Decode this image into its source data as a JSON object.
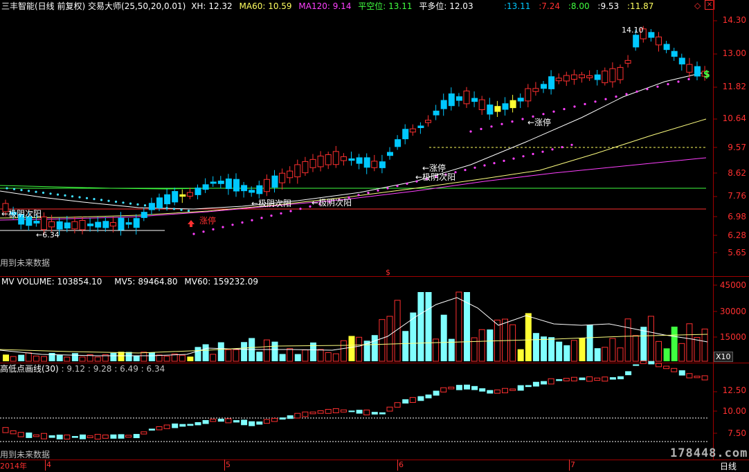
{
  "main_header": {
    "stock_name": "三丰智能(日线 前复权)",
    "indicator": "交易大师(25,50,20,0.01)",
    "xh_label": "XH:",
    "xh_value": "12.32",
    "ma60_label": "MA60:",
    "ma60_value": "10.59",
    "ma120_label": "MA120:",
    "ma120_value": "9.14",
    "pkw_label": "平空位:",
    "pkw_value": "13.11",
    "pdw_label": "平多位:",
    "pdw_value": "12.03",
    "right_values": [
      ":13.11",
      ":7.24",
      ":8.00",
      ":9.53",
      ":11.87"
    ]
  },
  "main_axis": [
    "14.30",
    "13.00",
    "11.82",
    "10.64",
    "9.57",
    "8.62",
    "7.76",
    "6.98",
    "6.28",
    "5.65"
  ],
  "main_annotations": {
    "high_label": "14.10",
    "low_label": "←6.34",
    "future_warning": "用到未来数据",
    "signal_jiyin1": "←极阴次阳",
    "signal_zhangting1": "涨停",
    "signal_jiyin2": "←极阴次阳",
    "signal_jiyin3": "←极阴次阳",
    "signal_zhangting2": "←涨停",
    "signal_jiyin4": "←极阴次阳",
    "signal_zhangting3": "←涨停",
    "dollar_mark": "$",
    "dollar_mark2": "$"
  },
  "volume_header": {
    "label": "MV VOLUME:",
    "value": "103854.10",
    "mv5_label": "MV5:",
    "mv5_value": "89464.80",
    "mv60_label": "MV60:",
    "mv60_value": "159232.09"
  },
  "volume_axis": [
    "45000",
    "30000",
    "15000"
  ],
  "volume_unit": "X10",
  "lower_header": {
    "label": "高低点画线(30)",
    "values": ": 9.12 : 9.28 : 6.49 : 6.34"
  },
  "lower_axis": [
    "12.50",
    "10.00",
    "7.50"
  ],
  "lower_future_warning": "用到未来数据",
  "time_axis": {
    "year_label": "2014年",
    "months": [
      "4",
      "5",
      "6",
      "7"
    ],
    "period": "日线"
  },
  "watermark": "178448.com",
  "colors": {
    "up": "#ff3030",
    "down": "#00c8ff",
    "limit": "#ffff33",
    "ma_white": "#ffffff",
    "ma_yellow": "#ffff80",
    "ma_magenta": "#ff40ff",
    "ma_green": "#40ff40",
    "grid_red": "#a00000"
  }
}
